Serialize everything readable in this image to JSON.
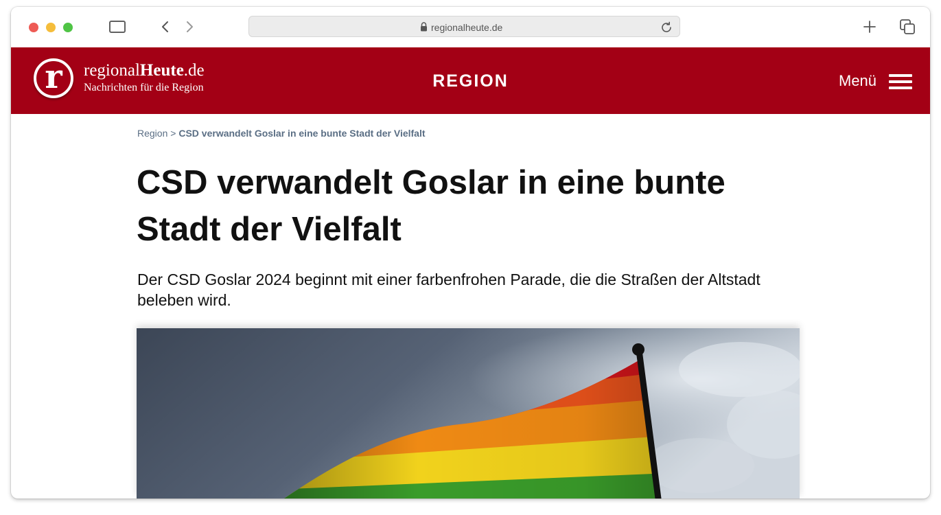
{
  "browser": {
    "url": "regionalheute.de"
  },
  "site": {
    "logo_letter": "r",
    "name_prefix": "regional",
    "name_bold": "Heute",
    "name_suffix": ".de",
    "tagline": "Nachrichten für die Region",
    "section": "REGION",
    "menu_label": "Menü",
    "brand_color": "#a30015"
  },
  "breadcrumb": {
    "parent": "Region",
    "separator": " > ",
    "current": "CSD verwandelt Goslar in eine bunte Stadt der Vielfalt"
  },
  "article": {
    "headline": "CSD verwandelt Goslar in eine bunte Stadt der Vielfalt",
    "teaser": "Der CSD Goslar 2024 beginnt mit einer farbenfrohen Parade, die die Straßen der Altstadt beleben wird.",
    "image_subject": "rainbow-flag-photo"
  }
}
